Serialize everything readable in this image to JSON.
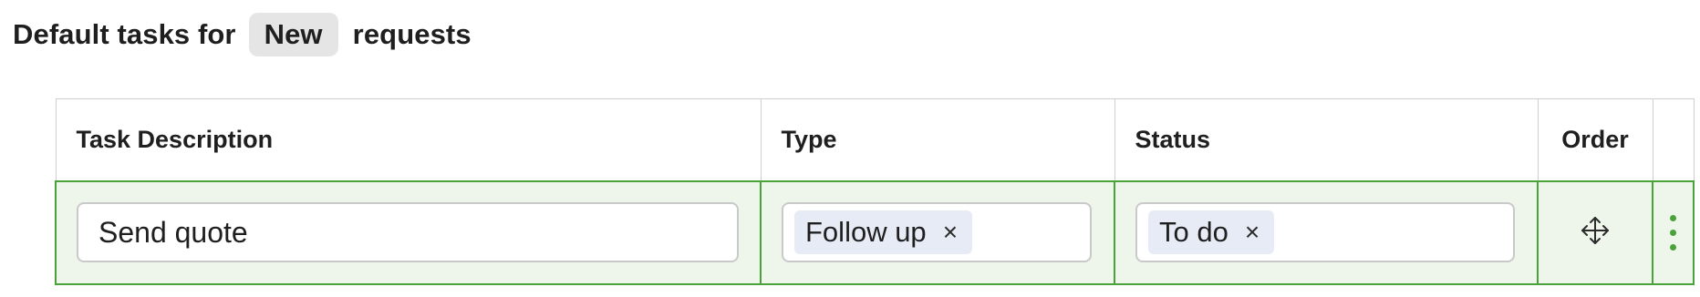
{
  "heading": {
    "prefix": "Default tasks for",
    "state": "New",
    "suffix": "requests"
  },
  "table": {
    "columns": [
      "Task Description",
      "Type",
      "Status",
      "Order",
      ""
    ],
    "rows": [
      {
        "description": "Send quote",
        "type": "Follow up",
        "status": "To do",
        "remove_symbol": "×",
        "order_icon": "move-icon",
        "menu_icon": "kebab-menu-icon"
      }
    ]
  },
  "colors": {
    "selected_row_background": "#eef6ec",
    "selected_row_border": "#4aa33a",
    "chip_background": "#e6ebf6",
    "pill_background": "#e5e5e5"
  }
}
